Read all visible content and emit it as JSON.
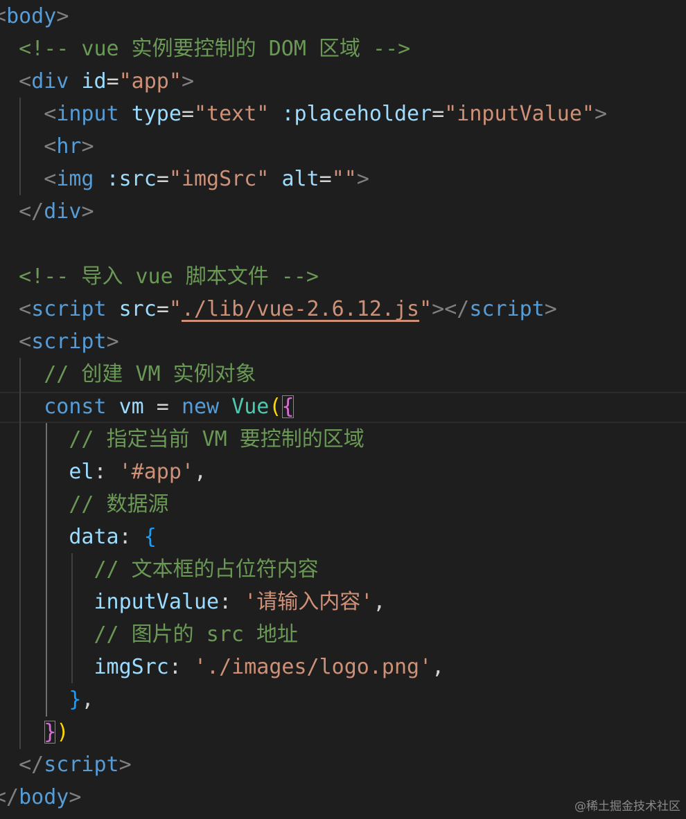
{
  "editor": {
    "lines": [
      {
        "t": [
          [
            "tag-bracket",
            "<"
          ],
          [
            "tag",
            "body"
          ],
          [
            "tag-bracket",
            ">"
          ]
        ]
      },
      {
        "t": [
          [
            "plain",
            "  "
          ],
          [
            "cmt",
            "<!-- vue 实例要控制的 DOM 区域 -->"
          ]
        ]
      },
      {
        "t": [
          [
            "plain",
            "  "
          ],
          [
            "tag-bracket",
            "<"
          ],
          [
            "tag",
            "div"
          ],
          [
            "plain",
            " "
          ],
          [
            "attr",
            "id"
          ],
          [
            "plain",
            "="
          ],
          [
            "str",
            "\"app\""
          ],
          [
            "tag-bracket",
            ">"
          ]
        ]
      },
      {
        "t": [
          [
            "plain",
            "    "
          ],
          [
            "tag-bracket",
            "<"
          ],
          [
            "tag",
            "input"
          ],
          [
            "plain",
            " "
          ],
          [
            "attr",
            "type"
          ],
          [
            "plain",
            "="
          ],
          [
            "str",
            "\"text\""
          ],
          [
            "plain",
            " "
          ],
          [
            "attr",
            ":placeholder"
          ],
          [
            "plain",
            "="
          ],
          [
            "str",
            "\"inputValue\""
          ],
          [
            "tag-bracket",
            ">"
          ]
        ]
      },
      {
        "t": [
          [
            "plain",
            "    "
          ],
          [
            "tag-bracket",
            "<"
          ],
          [
            "tag",
            "hr"
          ],
          [
            "tag-bracket",
            ">"
          ]
        ]
      },
      {
        "t": [
          [
            "plain",
            "    "
          ],
          [
            "tag-bracket",
            "<"
          ],
          [
            "tag",
            "img"
          ],
          [
            "plain",
            " "
          ],
          [
            "attr",
            ":src"
          ],
          [
            "plain",
            "="
          ],
          [
            "str",
            "\"imgSrc\""
          ],
          [
            "plain",
            " "
          ],
          [
            "attr",
            "alt"
          ],
          [
            "plain",
            "="
          ],
          [
            "str",
            "\"\""
          ],
          [
            "tag-bracket",
            ">"
          ]
        ]
      },
      {
        "t": [
          [
            "plain",
            "  "
          ],
          [
            "tag-bracket",
            "</"
          ],
          [
            "tag",
            "div"
          ],
          [
            "tag-bracket",
            ">"
          ]
        ]
      },
      {
        "t": []
      },
      {
        "t": [
          [
            "plain",
            "  "
          ],
          [
            "cmt",
            "<!-- 导入 vue 脚本文件 -->"
          ]
        ]
      },
      {
        "t": [
          [
            "plain",
            "  "
          ],
          [
            "tag-bracket",
            "<"
          ],
          [
            "tag",
            "script"
          ],
          [
            "plain",
            " "
          ],
          [
            "attr",
            "src"
          ],
          [
            "plain",
            "="
          ],
          [
            "str",
            "\""
          ],
          [
            "str link",
            "./lib/vue-2.6.12.js"
          ],
          [
            "str",
            "\""
          ],
          [
            "tag-bracket",
            "></"
          ],
          [
            "tag",
            "script"
          ],
          [
            "tag-bracket",
            ">"
          ]
        ]
      },
      {
        "t": [
          [
            "plain",
            "  "
          ],
          [
            "tag-bracket",
            "<"
          ],
          [
            "tag",
            "script"
          ],
          [
            "tag-bracket",
            ">"
          ]
        ]
      },
      {
        "t": [
          [
            "plain",
            "    "
          ],
          [
            "cmt",
            "// 创建 VM 实例对象"
          ]
        ]
      },
      {
        "t": [
          [
            "plain",
            "    "
          ],
          [
            "kw",
            "const"
          ],
          [
            "plain",
            " "
          ],
          [
            "id",
            "vm"
          ],
          [
            "plain",
            " = "
          ],
          [
            "kw",
            "new"
          ],
          [
            "plain",
            " "
          ],
          [
            "cls",
            "Vue"
          ],
          [
            "br-yellow",
            "("
          ],
          [
            "br-purple match-box",
            "{"
          ]
        ]
      },
      {
        "t": [
          [
            "plain",
            "      "
          ],
          [
            "cmt",
            "// 指定当前 VM 要控制的区域"
          ]
        ]
      },
      {
        "t": [
          [
            "plain",
            "      "
          ],
          [
            "id",
            "el"
          ],
          [
            "plain",
            ": "
          ],
          [
            "str",
            "'#app'"
          ],
          [
            "plain",
            ","
          ]
        ]
      },
      {
        "t": [
          [
            "plain",
            "      "
          ],
          [
            "cmt",
            "// 数据源"
          ]
        ]
      },
      {
        "t": [
          [
            "plain",
            "      "
          ],
          [
            "id",
            "data"
          ],
          [
            "plain",
            ": "
          ],
          [
            "br-blue",
            "{"
          ]
        ]
      },
      {
        "t": [
          [
            "plain",
            "        "
          ],
          [
            "cmt",
            "// 文本框的占位符内容"
          ]
        ]
      },
      {
        "t": [
          [
            "plain",
            "        "
          ],
          [
            "id",
            "inputValue"
          ],
          [
            "plain",
            ": "
          ],
          [
            "str",
            "'请输入内容'"
          ],
          [
            "plain",
            ","
          ]
        ]
      },
      {
        "t": [
          [
            "plain",
            "        "
          ],
          [
            "cmt",
            "// 图片的 src 地址"
          ]
        ]
      },
      {
        "t": [
          [
            "plain",
            "        "
          ],
          [
            "id",
            "imgSrc"
          ],
          [
            "plain",
            ": "
          ],
          [
            "str",
            "'./images/logo.png'"
          ],
          [
            "plain",
            ","
          ]
        ]
      },
      {
        "t": [
          [
            "plain",
            "      "
          ],
          [
            "br-blue",
            "}"
          ],
          [
            "plain",
            ","
          ]
        ]
      },
      {
        "t": [
          [
            "plain",
            "    "
          ],
          [
            "br-purple match-box",
            "}"
          ],
          [
            "br-yellow",
            ")"
          ]
        ]
      },
      {
        "t": [
          [
            "plain",
            "  "
          ],
          [
            "tag-bracket",
            "</"
          ],
          [
            "tag",
            "script"
          ],
          [
            "tag-bracket",
            ">"
          ]
        ]
      },
      {
        "t": [
          [
            "tag-bracket",
            "</"
          ],
          [
            "tag",
            "body"
          ],
          [
            "tag-bracket",
            ">"
          ]
        ]
      }
    ]
  },
  "watermark": "@稀土掘金技术社区"
}
